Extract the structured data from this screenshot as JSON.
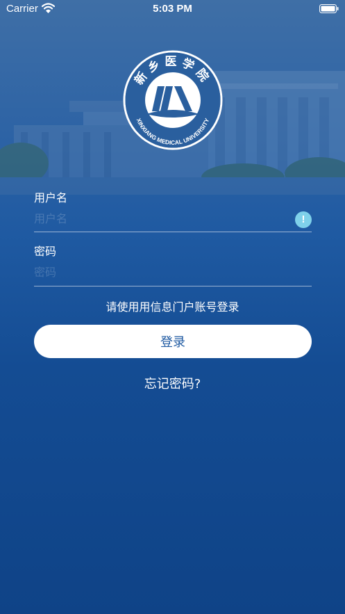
{
  "status_bar": {
    "carrier": "Carrier",
    "time": "5:03 PM"
  },
  "logo": {
    "chinese_name": "新乡医学院",
    "english_name": "XINXIANG MEDICAL UNIVERSITY"
  },
  "form": {
    "username_label": "用户名",
    "username_placeholder": "用户名",
    "username_value": "",
    "password_label": "密码",
    "password_placeholder": "密码",
    "password_value": "",
    "warning_icon": "exclamation-icon",
    "hint": "请使用用信息门户账号登录",
    "login_label": "登录",
    "forgot_label": "忘记密码?"
  },
  "colors": {
    "background_top": "#3f6fa6",
    "background_bottom": "#0f4387",
    "button_text": "#1f5aa2",
    "warning": "#7fd1ea"
  }
}
